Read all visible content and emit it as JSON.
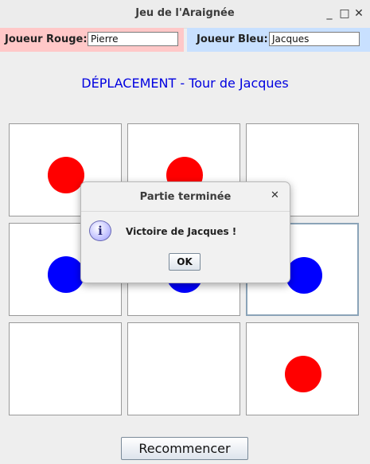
{
  "window": {
    "title": "Jeu de l'Araignée",
    "minimize": "_",
    "maximize": "□",
    "close": "✕"
  },
  "players": {
    "red_label": "Joueur Rouge:",
    "red_name": "Pierre",
    "blue_label": "Joueur Bleu:",
    "blue_name": "Jacques",
    "red_color": "#ffc8c8",
    "blue_color": "#c8e0ff"
  },
  "status": "DÉPLACEMENT - Tour de Jacques",
  "board": {
    "rows": [
      [
        "red",
        "red",
        ""
      ],
      [
        "blue",
        "blue",
        "blue"
      ],
      [
        "",
        "",
        "red"
      ]
    ],
    "selected": [
      1,
      2
    ]
  },
  "restart_label": "Recommencer",
  "dialog": {
    "title": "Partie terminée",
    "close": "✕",
    "icon": "info-icon",
    "icon_glyph": "i",
    "message": "Victoire de Jacques !",
    "ok_label": "OK"
  }
}
